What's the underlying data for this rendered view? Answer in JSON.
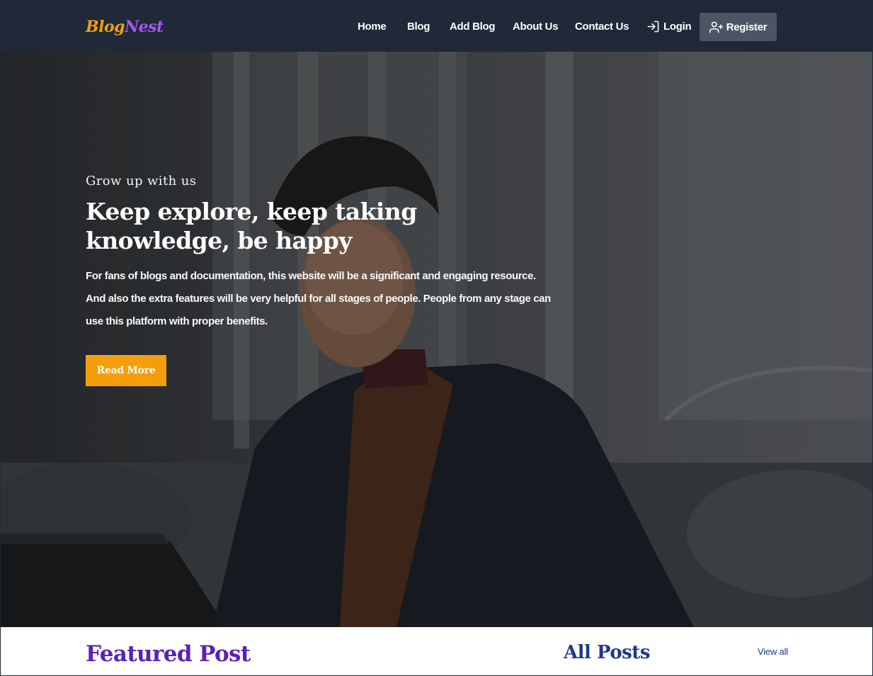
{
  "brand": {
    "logo_part1": "Blog",
    "logo_part2": "Nest",
    "color1": "#f59e0b",
    "color2": "#a855f7"
  },
  "nav": {
    "items": [
      {
        "label": "Home"
      },
      {
        "label": "Blog"
      },
      {
        "label": "Add Blog"
      },
      {
        "label": "About Us"
      },
      {
        "label": "Contact Us"
      }
    ],
    "login_label": "Login",
    "login_icon": "login-arrow-icon",
    "register_label": "Register",
    "register_icon": "user-plus-icon"
  },
  "hero": {
    "eyebrow": "Grow up with us",
    "headline": "Keep explore, keep taking knowledge, be happy",
    "description": "For fans of blogs and documentation, this website will be a significant and engaging resource. And also the extra features will be very helpful for all stages of people. People from any stage can use this platform with proper benefits.",
    "cta_label": "Read More",
    "cta_color": "#f59e0b"
  },
  "sections": {
    "featured_title": "Featured Post",
    "all_posts_title": "All Posts",
    "view_all_label": "View all"
  }
}
